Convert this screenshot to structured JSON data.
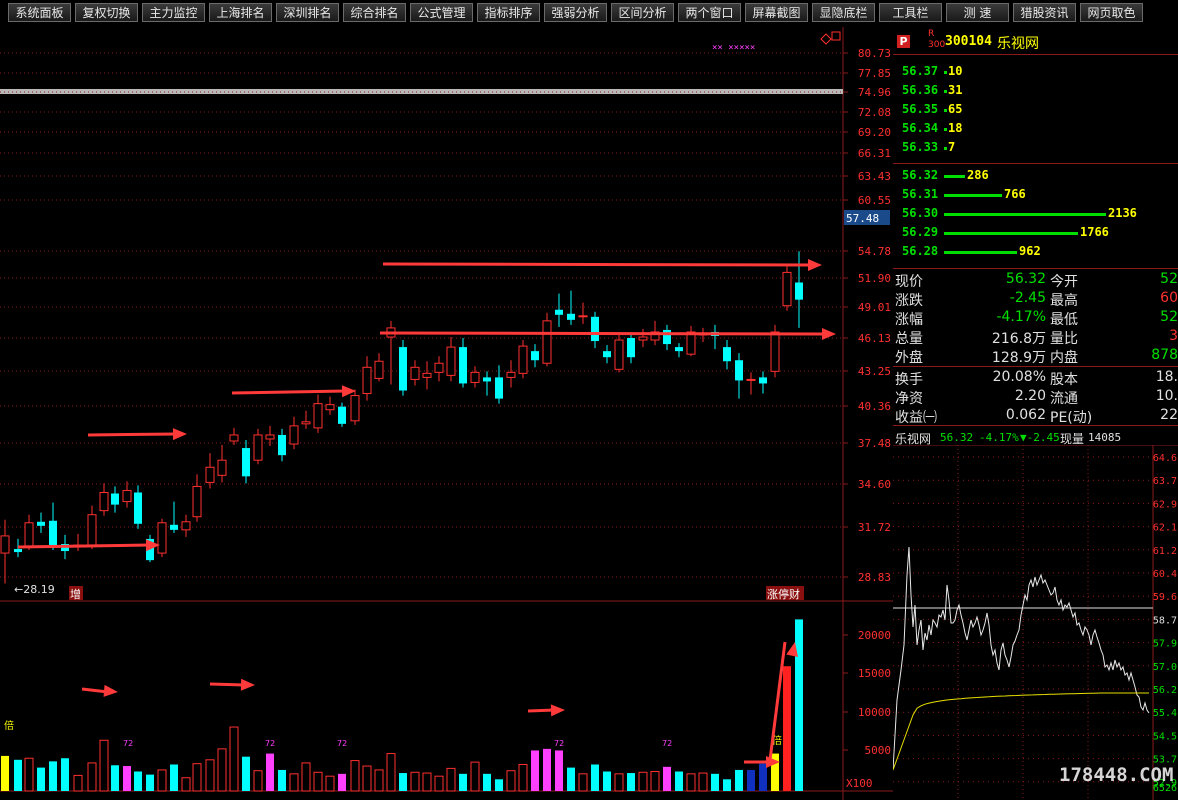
{
  "toolbar": {
    "buttons": [
      "系统面板",
      "复权切换",
      "主力监控",
      "上海排名",
      "深圳排名",
      "综合排名",
      "公式管理",
      "指标排序",
      "强弱分析",
      "区间分析",
      "两个窗口",
      "屏幕截图",
      "显隐底栏",
      "工具栏",
      "测 速",
      "猎股资讯",
      "网页取色"
    ]
  },
  "header": {
    "p_badge": "P",
    "r_badge": "R",
    "r_sub": "300",
    "code": "300104",
    "name": "乐视网"
  },
  "price_axis": {
    "labels": [
      "80.73",
      "77.85",
      "74.96",
      "72.08",
      "69.20",
      "66.31",
      "63.43",
      "60.55",
      "57.48",
      "54.78",
      "51.90",
      "49.01",
      "46.13",
      "43.25",
      "40.36",
      "37.48",
      "34.60",
      "31.72",
      "28.83"
    ],
    "current_price_tag": "57.48"
  },
  "volume_axis": {
    "labels": [
      "20000",
      "15000",
      "10000",
      "5000"
    ],
    "multiplier": "X100"
  },
  "chart_annotations": {
    "low_marker": "←28.19",
    "zeng_tag": "增",
    "limit_tag": "涨停财",
    "vol_tag": "倍",
    "vol_tag2": "倍",
    "vol_mark": "72",
    "corner_marks": "×× ×××××"
  },
  "order_book": {
    "asks": [
      {
        "price": "56.37",
        "vol": "10"
      },
      {
        "price": "56.36",
        "vol": "31"
      },
      {
        "price": "56.35",
        "vol": "65"
      },
      {
        "price": "56.34",
        "vol": "18"
      },
      {
        "price": "56.33",
        "vol": "7"
      }
    ],
    "bids": [
      {
        "price": "56.32",
        "vol": "286",
        "frac": 0.13
      },
      {
        "price": "56.31",
        "vol": "766",
        "frac": 0.36
      },
      {
        "price": "56.30",
        "vol": "2136",
        "frac": 1.0
      },
      {
        "price": "56.29",
        "vol": "1766",
        "frac": 0.83
      },
      {
        "price": "56.28",
        "vol": "962",
        "frac": 0.45
      }
    ]
  },
  "quote": {
    "rows": [
      {
        "l1": "现价",
        "v1": "56.32",
        "l2": "今开",
        "v2": "52"
      },
      {
        "l1": "涨跌",
        "v1": "-2.45",
        "l2": "最高",
        "v2": "60"
      },
      {
        "l1": "涨幅",
        "v1": "-4.17%",
        "l2": "最低",
        "v2": "52"
      },
      {
        "l1": "总量",
        "v1": "216.8万",
        "l2": "量比",
        "v2": "3"
      },
      {
        "l1": "外盘",
        "v1": "128.9万",
        "l2": "内盘",
        "v2": "878"
      }
    ],
    "rows2": [
      {
        "l1": "换手",
        "v1": "20.08%",
        "l2": "股本",
        "v2": "18."
      },
      {
        "l1": "净资",
        "v1": "2.20",
        "l2": "流通",
        "v2": "10."
      },
      {
        "l1": "收益㈠",
        "v1": "0.062",
        "l2": "PE(动)",
        "v2": "22"
      }
    ]
  },
  "intraday": {
    "name": "乐视网",
    "price": "56.32",
    "pct": "-4.17%",
    "chg": "▼-2.45",
    "vol_label": "现量",
    "vol": "14085",
    "axis": [
      "64.6",
      "63.7",
      "62.9",
      "62.1",
      "61.2",
      "60.4",
      "59.6",
      "58.7",
      "57.9",
      "57.0",
      "56.2",
      "55.4",
      "54.5",
      "53.7",
      "52.9"
    ],
    "bottom_label": "6526"
  },
  "watermark": "178448.COM",
  "colors": {
    "up": "#ff3030",
    "down": "#00ffff",
    "grid": "#8a1a1a",
    "accent": "#ffff00",
    "green": "#00e000",
    "arrow": "#ff3a3a"
  }
}
